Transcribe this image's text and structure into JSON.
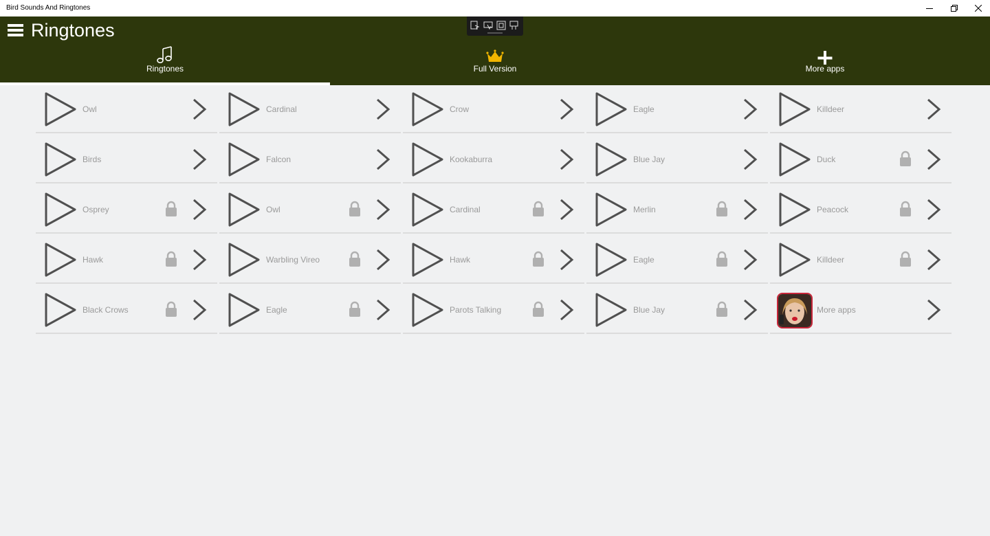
{
  "window": {
    "title": "Bird Sounds And Ringtones",
    "buttons": [
      "minimize-icon",
      "restore-icon",
      "close-icon"
    ]
  },
  "app": {
    "title": "Ringtones",
    "header_color": "#2d370c",
    "accent": "#ffffff"
  },
  "tabs": [
    {
      "label": "Ringtones",
      "icon": "music-notes-icon",
      "selected": true
    },
    {
      "label": "Full Version",
      "icon": "crown-icon",
      "selected": false
    },
    {
      "label": "More apps",
      "icon": "plus-icon",
      "selected": false
    }
  ],
  "ringtones": [
    {
      "name": "Owl",
      "locked": false
    },
    {
      "name": "Cardinal",
      "locked": false
    },
    {
      "name": "Crow",
      "locked": false
    },
    {
      "name": "Eagle",
      "locked": false
    },
    {
      "name": "Killdeer",
      "locked": false
    },
    {
      "name": "Birds",
      "locked": false
    },
    {
      "name": "Falcon",
      "locked": false
    },
    {
      "name": "Kookaburra",
      "locked": false
    },
    {
      "name": "Blue Jay",
      "locked": false
    },
    {
      "name": "Duck",
      "locked": true
    },
    {
      "name": "Osprey",
      "locked": true
    },
    {
      "name": "Owl",
      "locked": true
    },
    {
      "name": "Cardinal",
      "locked": true
    },
    {
      "name": "Merlin",
      "locked": true
    },
    {
      "name": "Peacock",
      "locked": true
    },
    {
      "name": "Hawk",
      "locked": true
    },
    {
      "name": "Warbling Vireo",
      "locked": true
    },
    {
      "name": "Hawk",
      "locked": true
    },
    {
      "name": "Eagle",
      "locked": true
    },
    {
      "name": "Killdeer",
      "locked": true
    },
    {
      "name": "Black Crows",
      "locked": true
    },
    {
      "name": "Eagle",
      "locked": true
    },
    {
      "name": "Parots Talking",
      "locked": true
    },
    {
      "name": "Blue Jay",
      "locked": true
    },
    {
      "name": "More apps",
      "locked": false,
      "thumbnail": true
    }
  ]
}
